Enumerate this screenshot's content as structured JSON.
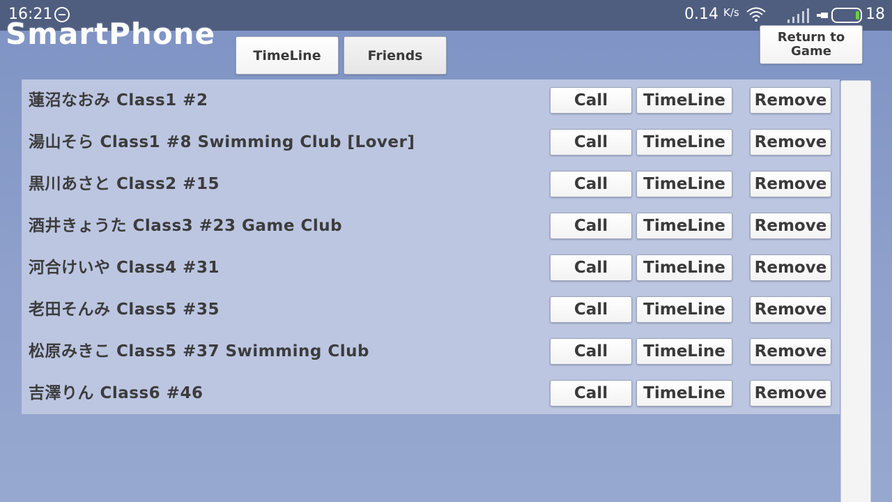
{
  "statusbar": {
    "time": "16:21",
    "speed": "0.14",
    "speed_unit": "K/s",
    "battery_level": "18",
    "icons": [
      "app-notification-icon",
      "wifi-icon",
      "signal-icon",
      "battery-icon"
    ]
  },
  "app": {
    "title": "SmartPhone",
    "return_label": "Return to\nGame"
  },
  "tabs": [
    {
      "label": "TimeLine",
      "active": false
    },
    {
      "label": "Friends",
      "active": true
    }
  ],
  "row_buttons": {
    "call": "Call",
    "timeline": "TimeLine",
    "remove": "Remove"
  },
  "friends": [
    {
      "name": "蓮沼なおみ Class1 #2"
    },
    {
      "name": "湯山そら Class1 #8 Swimming Club [Lover]"
    },
    {
      "name": "黒川あさと Class2 #15"
    },
    {
      "name": "酒井きょうた Class3 #23 Game Club"
    },
    {
      "name": "河合けいや Class4 #31"
    },
    {
      "name": "老田そんみ Class5 #35"
    },
    {
      "name": "松原みきこ Class5 #37 Swimming Club"
    },
    {
      "name": "吉澤りん Class6 #46"
    }
  ],
  "colors": {
    "background": "#8ea0cb",
    "statusbar": "#4f5d7f",
    "list_background": "#bcc6e1",
    "button_text": "#3a3a3a"
  }
}
